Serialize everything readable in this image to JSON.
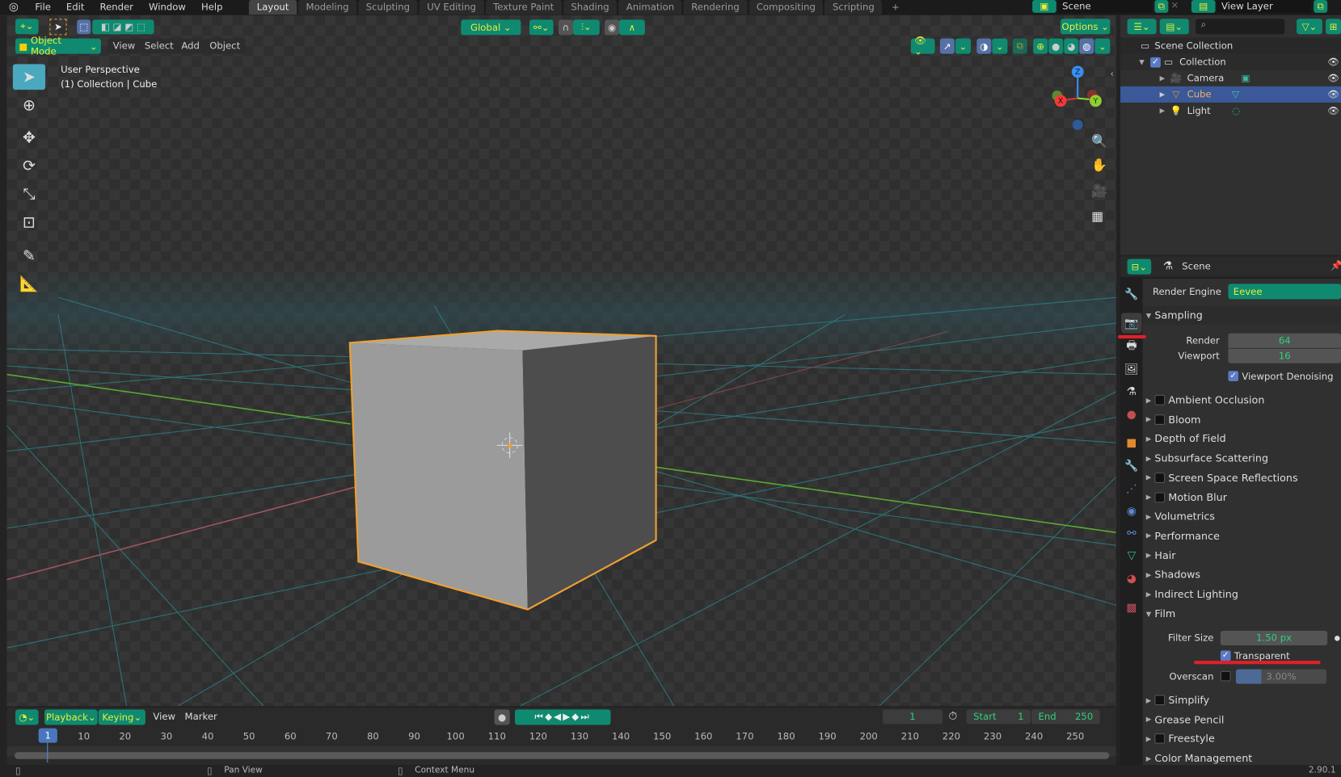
{
  "topbar": {
    "menus": [
      "File",
      "Edit",
      "Render",
      "Window",
      "Help"
    ],
    "workspaces": [
      "Layout",
      "Modeling",
      "Sculpting",
      "UV Editing",
      "Texture Paint",
      "Shading",
      "Animation",
      "Rendering",
      "Compositing",
      "Scripting"
    ],
    "active_workspace": "Layout",
    "add_workspace": "+",
    "scene": "Scene",
    "view_layer": "View Layer"
  },
  "tool_header": {
    "orientation": "Global",
    "options": "Options"
  },
  "viewport_header": {
    "mode": "Object Mode",
    "menus": [
      "View",
      "Select",
      "Add",
      "Object"
    ]
  },
  "viewport": {
    "perspective": "User Perspective",
    "collection_info": "(1) Collection | Cube",
    "gizmo": {
      "z": "Z",
      "x": "X",
      "y": "Y"
    }
  },
  "outliner": {
    "root": "Scene Collection",
    "items": [
      {
        "label": "Collection",
        "type": "collection"
      },
      {
        "label": "Camera",
        "type": "camera"
      },
      {
        "label": "Cube",
        "type": "mesh",
        "selected": true
      },
      {
        "label": "Light",
        "type": "light"
      }
    ]
  },
  "properties": {
    "context": "Scene",
    "render_engine_label": "Render Engine",
    "render_engine": "Eevee",
    "sampling": {
      "title": "Sampling",
      "render_label": "Render",
      "render": "64",
      "viewport_label": "Viewport",
      "viewport": "16",
      "denoise": "Viewport Denoising"
    },
    "sections": [
      "Ambient Occlusion",
      "Bloom",
      "Depth of Field",
      "Subsurface Scattering",
      "Screen Space Reflections",
      "Motion Blur",
      "Volumetrics",
      "Performance",
      "Hair",
      "Shadows",
      "Indirect Lighting"
    ],
    "film": {
      "title": "Film",
      "filter_size_label": "Filter Size",
      "filter_size": "1.50 px",
      "transparent": "Transparent",
      "transparent_checked": true,
      "overscan_label": "Overscan",
      "overscan": "3.00%"
    },
    "sections_after": [
      "Simplify",
      "Grease Pencil",
      "Freestyle",
      "Color Management"
    ],
    "highlight_color": "#e0202a"
  },
  "timeline": {
    "menus": [
      "Playback",
      "Keying",
      "View",
      "Marker"
    ],
    "current_frame": "1",
    "start_label": "Start",
    "start": "1",
    "end_label": "End",
    "end": "250",
    "ticks": [
      "10",
      "20",
      "30",
      "40",
      "50",
      "60",
      "70",
      "80",
      "90",
      "100",
      "110",
      "120",
      "130",
      "140",
      "150",
      "160",
      "170",
      "180",
      "190",
      "200",
      "210",
      "220",
      "230",
      "240",
      "250"
    ],
    "playhead": "1"
  },
  "statusbar": {
    "pan": "Pan View",
    "context": "Context Menu",
    "version": "2.90.1"
  },
  "colors": {
    "accent": "#0f8a70",
    "selection": "#3b5998",
    "outline": "#f0a030"
  }
}
